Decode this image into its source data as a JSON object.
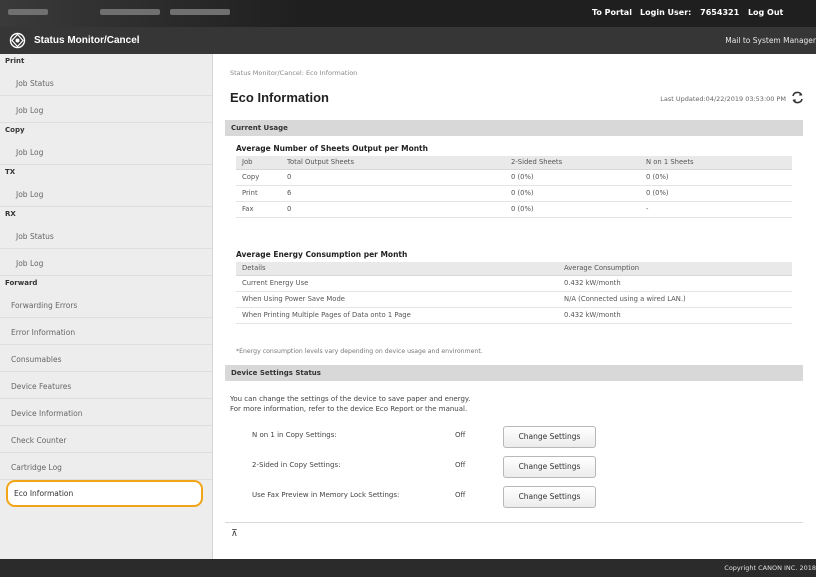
{
  "topbar": {
    "portal_link": "To Portal",
    "login_label": "Login User:",
    "login_user": "7654321",
    "logout_link": "Log Out"
  },
  "app": {
    "title": "Status Monitor/Cancel",
    "mail_link": "Mail to System Manager",
    "icon": "status-monitor-icon"
  },
  "sidebar": {
    "sections": [
      {
        "title": "Print",
        "items": [
          "Job Status",
          "Job Log"
        ]
      },
      {
        "title": "Copy",
        "items": [
          "Job Log"
        ]
      },
      {
        "title": "TX",
        "items": [
          "Job Log"
        ]
      },
      {
        "title": "RX",
        "items": [
          "Job Status",
          "Job Log"
        ]
      },
      {
        "title": "Forward",
        "items": [
          "Forwarding Errors"
        ]
      }
    ],
    "items": [
      "Error Information",
      "Consumables",
      "Device Features",
      "Device Information",
      "Check Counter",
      "Cartridge Log",
      "Eco Information"
    ],
    "active_item": "Eco Information"
  },
  "main": {
    "breadcrumb": "Status Monitor/Cancel: Eco Information",
    "title": "Eco Information",
    "last_updated": "Last Updated:04/22/2019 03:53:00 PM",
    "current_usage": {
      "title": "Current Usage",
      "sheets": {
        "title": "Average Number of Sheets Output per Month",
        "headers": [
          "Job",
          "Total Output Sheets",
          "2-Sided Sheets",
          "N on 1 Sheets"
        ],
        "rows": [
          [
            "Copy",
            "0",
            "0 (0%)",
            "0 (0%)"
          ],
          [
            "Print",
            "6",
            "0 (0%)",
            "0 (0%)"
          ],
          [
            "Fax",
            "0",
            "0 (0%)",
            "-"
          ]
        ]
      },
      "energy": {
        "title": "Average Energy Consumption per Month",
        "headers": [
          "Details",
          "Average Consumption"
        ],
        "rows": [
          [
            "Current Energy Use",
            "0.432 kW/month"
          ],
          [
            "When Using Power Save Mode",
            "N/A (Connected using a wired LAN.)"
          ],
          [
            "When Printing Multiple Pages of Data onto 1 Page",
            "0.432 kW/month"
          ]
        ]
      },
      "note": "*Energy consumption levels vary depending on device usage and environment."
    },
    "device_settings": {
      "title": "Device Settings Status",
      "desc_line1": "You can change the settings of the device to save paper and energy.",
      "desc_line2": "For more information, refer to the device Eco Report or the manual.",
      "settings": [
        {
          "label": "N on 1 in Copy Settings:",
          "value": "Off",
          "button": "Change Settings"
        },
        {
          "label": "2-Sided in Copy Settings:",
          "value": "Off",
          "button": "Change Settings"
        },
        {
          "label": "Use Fax Preview in Memory Lock Settings:",
          "value": "Off",
          "button": "Change Settings"
        }
      ]
    },
    "to_top": "⊼"
  },
  "footer": {
    "copyright": "Copyright CANON INC. 2018"
  }
}
